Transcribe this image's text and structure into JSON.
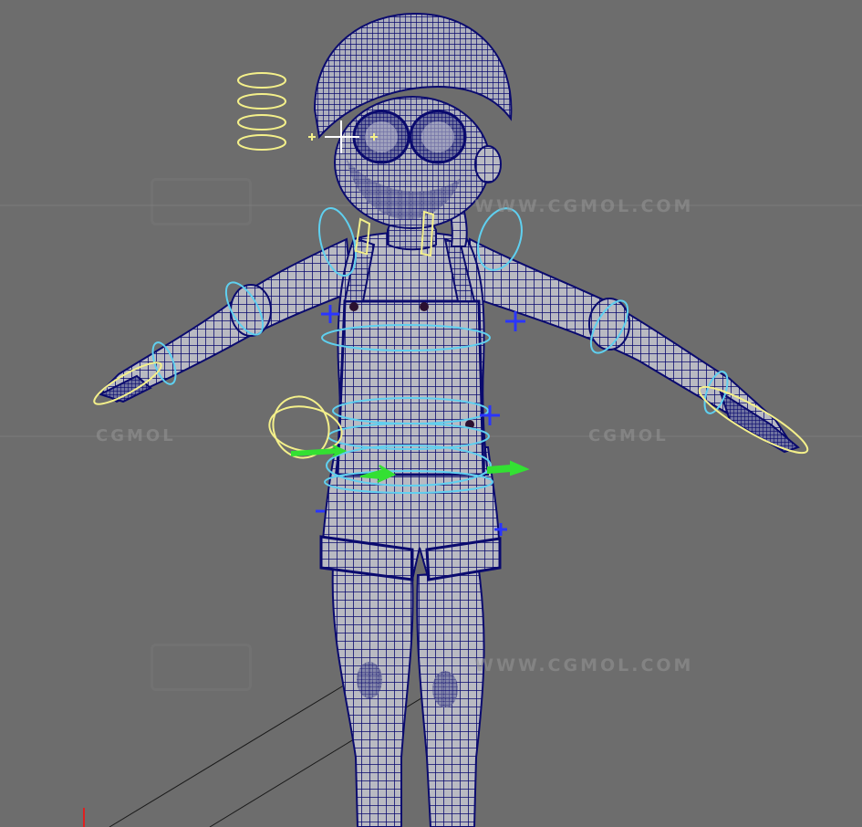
{
  "viewport": {
    "background": "#6d6d6d",
    "wireframe_color": "#0a0a6e",
    "skin_color": "#b9bac2",
    "controller_colors": {
      "cyan": "#5fd0f0",
      "yellow": "#f4f08a",
      "blue": "#2a35ff",
      "green": "#33e033"
    }
  },
  "watermarks": {
    "site_top": "WWW.CGMOL.COM",
    "site_bottom": "WWW.CGMOL.COM",
    "logo_left": "CGMOL",
    "logo_right": "CGMOL"
  },
  "scene": {
    "subject": "rigged character wireframe",
    "controls": [
      "face-control-rings",
      "shoulder-ring-left",
      "shoulder-ring-right",
      "chest-ring",
      "hip-ring",
      "wrist-ring-left",
      "wrist-ring-right",
      "pole-vector-crosses",
      "ik-arrows"
    ]
  }
}
